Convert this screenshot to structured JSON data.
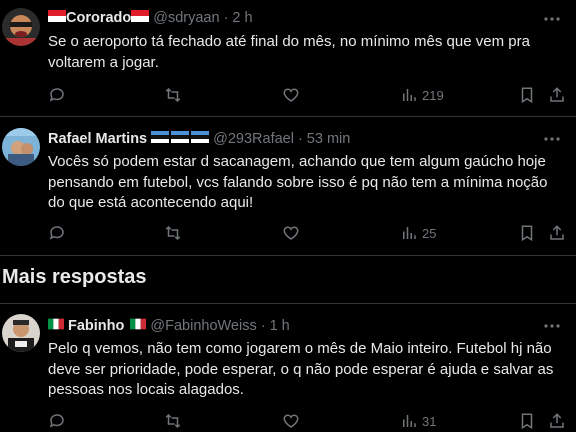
{
  "tweets": [
    {
      "name": "Cororado",
      "handle": "@sdryaan",
      "time": "2 h",
      "text": "Se o aeroporto tá fechado até final do mês, no mínimo mês que vem pra voltarem a jogar.",
      "views": "219",
      "name_flags": [
        "flag-indonesia-icon",
        "flag-indonesia-icon"
      ]
    },
    {
      "name": "Rafael Martins",
      "handle": "@293Rafael",
      "time": "53 min",
      "text": "Vocês só podem estar d sacanagem, achando que tem algum gaúcho hoje pensando em futebol, vcs falando sobre isso é pq não tem a mínima noção do que está acontecendo aqui!",
      "views": "25",
      "name_flags": [
        "flag-estonia-icon",
        "flag-estonia-icon",
        "flag-estonia-icon"
      ]
    },
    {
      "name": "Fabinho",
      "handle": "@FabinhoWeiss",
      "time": "1 h",
      "text": "Pelo q vemos, não tem como jogarem o mês de Maio inteiro. Futebol hj não deve ser prioridade, pode esperar, o q não pode esperar é ajuda e salvar as pessoas nos locais alagados.",
      "views": "31",
      "name_flags": [
        "flag-italy-icon",
        "flag-italy-icon"
      ]
    }
  ],
  "section": {
    "more_replies": "Mais respostas"
  },
  "separator": "·",
  "colors": {
    "background": "#000000",
    "text": "#e7e9ea",
    "muted": "#71767b",
    "divider": "#2f3336"
  }
}
